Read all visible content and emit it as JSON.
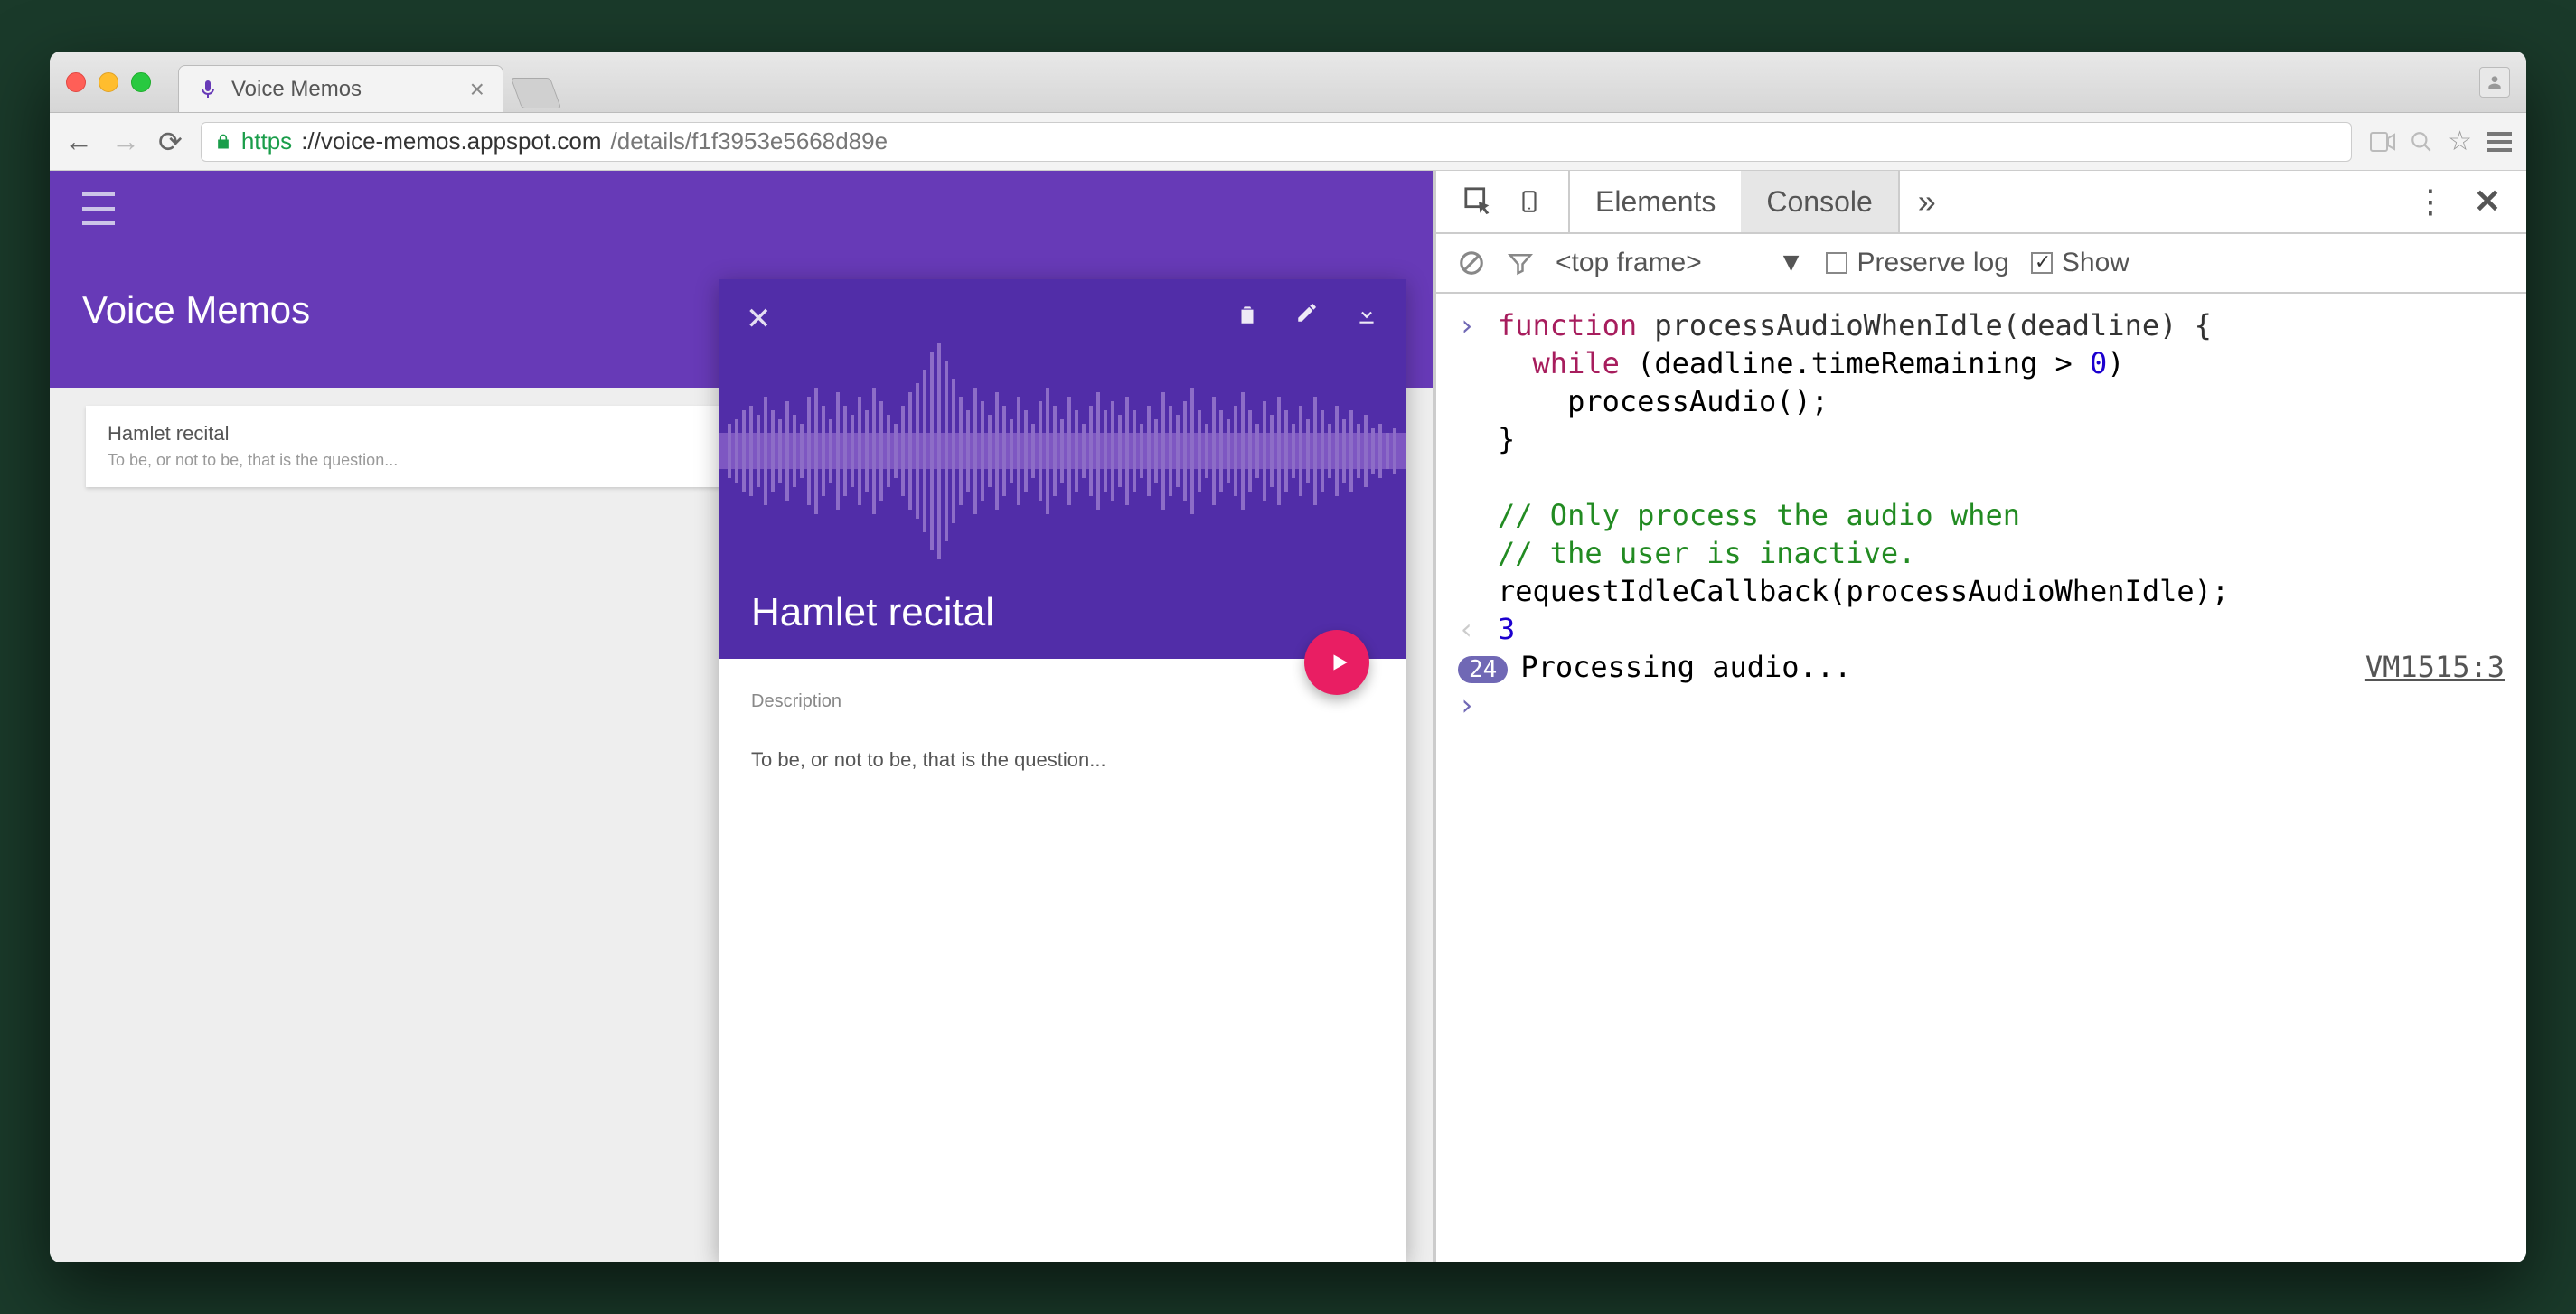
{
  "browser": {
    "tab_title": "Voice Memos",
    "url_protocol": "https",
    "url_host": "://voice-memos.appspot.com",
    "url_path": "/details/f1f3953e5668d89e"
  },
  "app": {
    "title": "Voice Memos",
    "list": {
      "item_title": "Hamlet recital",
      "item_subtitle": "To be, or not to be, that is the question..."
    },
    "detail": {
      "title": "Hamlet recital",
      "description_label": "Description",
      "description_text": "To be, or not to be, that is the question..."
    }
  },
  "devtools": {
    "tabs": {
      "elements": "Elements",
      "console": "Console",
      "more": "»"
    },
    "filter": {
      "frame_label": "<top frame>",
      "preserve_log": "Preserve log",
      "show": "Show"
    },
    "console": {
      "code_line1": "function processAudioWhenIdle(deadline) {",
      "code_line2": "  while (deadline.timeRemaining > 0)",
      "code_line3": "    processAudio();",
      "code_line4": "}",
      "code_line5": "",
      "code_line6": "// Only process the audio when",
      "code_line7": "// the user is inactive.",
      "code_line8": "requestIdleCallback(processAudioWhenIdle);",
      "return_value": "3",
      "log_count": "24",
      "log_message": "Processing audio...",
      "log_source": "VM1515:3"
    }
  }
}
